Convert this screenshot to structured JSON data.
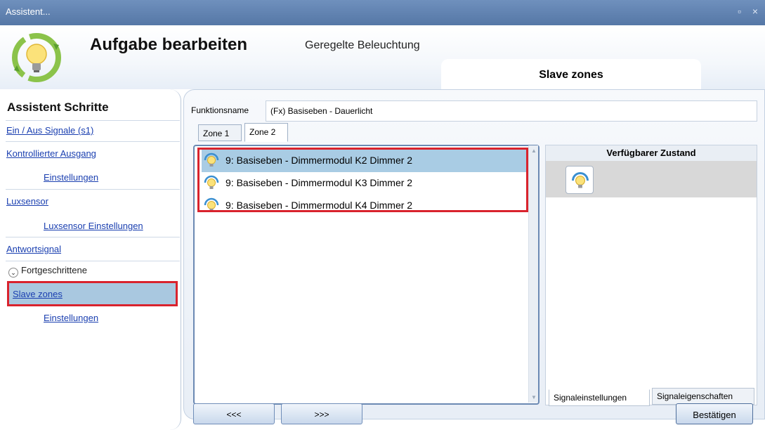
{
  "window": {
    "title": "Assistent...",
    "controls": "▫ ×"
  },
  "header": {
    "title": "Aufgabe bearbeiten",
    "subtitle": "Geregelte Beleuchtung",
    "step": "Slave zones"
  },
  "sidebar": {
    "title": "Assistent Schritte",
    "items": [
      {
        "label": "Ein / Aus Signale (s1)"
      },
      {
        "label": "Kontrollierter Ausgang"
      },
      {
        "label": "Einstellungen"
      },
      {
        "label": "Luxsensor"
      },
      {
        "label": "Luxsensor Einstellungen"
      },
      {
        "label": "Antwortsignal"
      }
    ],
    "advanced_label": "Fortgeschrittene",
    "advanced_items": [
      {
        "label": "Slave zones"
      },
      {
        "label": "Einstellungen"
      }
    ]
  },
  "form": {
    "function_name_label": "Funktionsname",
    "function_name_value": "(Fx) Basiseben - Dauerlicht"
  },
  "tabs": [
    {
      "label": "Zone 1"
    },
    {
      "label": "Zone 2"
    }
  ],
  "list": {
    "rows": [
      {
        "label": "9: Basiseben - Dimmermodul K2 Dimmer 2",
        "selected": true
      },
      {
        "label": "9: Basiseben - Dimmermodul K3 Dimmer 2",
        "selected": false
      },
      {
        "label": "9: Basiseben - Dimmermodul K4 Dimmer 2",
        "selected": false
      }
    ]
  },
  "right_panel": {
    "heading": "Verfügbarer Zustand",
    "tabs": [
      {
        "label": "Signaleinstellungen"
      },
      {
        "label": "Signaleigenschaften"
      }
    ]
  },
  "footer": {
    "prev_label": "<<<",
    "next_label": ">>>",
    "confirm_label": "Bestätigen"
  },
  "colors": {
    "titlebar": "#5a7cab",
    "selection": "#a9cce4",
    "highlight": "#d9232d",
    "link": "#1a3fb0"
  },
  "icons": [
    "lightbulb-icon",
    "refresh-arrows-icon",
    "chevron-down-icon"
  ]
}
